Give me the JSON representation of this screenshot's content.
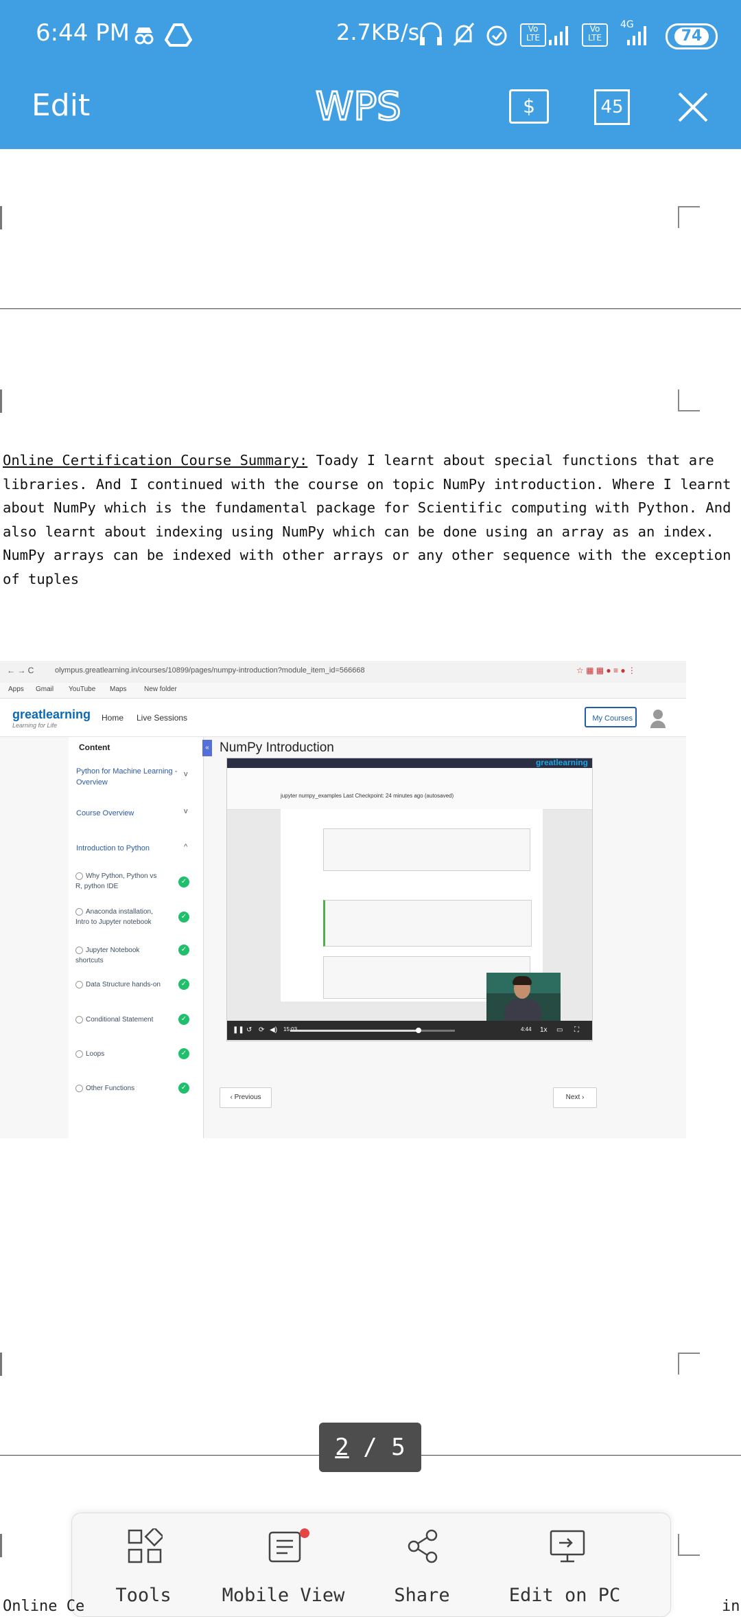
{
  "status_bar": {
    "time": "6:44 PM",
    "net_speed": "2.7KB/s",
    "network_type": "4G",
    "lte_label": "Vo LTE",
    "battery": "74"
  },
  "app_bar": {
    "edit_label": "Edit",
    "logo_text": "WPS",
    "page_count_badge": "45",
    "accent_color": "#3f9fe2"
  },
  "document": {
    "summary_label": "Online Certification Course Summary:",
    "summary_text": " Toady I learnt about special functions that are libraries. And I continued with the course on topic NumPy introduction. Where I learnt about NumPy which is the fundamental package for Scientific computing with Python. And also learnt about indexing using NumPy which can be done using an array as an index. NumPy arrays can be indexed with other arrays or any other sequence with the exception of tuples",
    "cutoff_text_left": "Online Ce",
    "cutoff_text_right": "in"
  },
  "embedded_screenshot": {
    "url": "olympus.greatlearning.in/courses/10899/pages/numpy-introduction?module_item_id=566668",
    "bookmarks": [
      "Apps",
      "Gmail",
      "YouTube",
      "Maps",
      "New folder"
    ],
    "site_logo": "greatlearning",
    "site_tagline": "Learning for Life",
    "nav": {
      "home": "Home",
      "live_sessions": "Live Sessions",
      "my_courses": "My Courses"
    },
    "sidebar_heading": "Content",
    "sidebar_sections": [
      {
        "label": "Python for Machine Learning - Overview",
        "chevron": "v"
      },
      {
        "label": "Course Overview",
        "chevron": "v"
      },
      {
        "label": "Introduction to Python",
        "chevron": "^"
      }
    ],
    "sidebar_lessons": [
      "Why Python, Python vs R, python IDE",
      "Anaconda installation, Intro to Jupyter notebook",
      "Jupyter Notebook shortcuts",
      "Data Structure hands-on",
      "Conditional Statement",
      "Loops",
      "Other Functions"
    ],
    "main_title": "NumPy Introduction",
    "video": {
      "brand": "greatlearning",
      "notebook_title": "jupyter  numpy_examples  Last Checkpoint: 24 minutes ago  (autosaved)",
      "time_elapsed": "15:03",
      "time_remaining": "4:44",
      "speed": "1x",
      "progress": 0.78
    },
    "prev_label": "Previous",
    "next_label": "Next"
  },
  "page_indicator": {
    "current": "2",
    "separator": "/",
    "total": "5"
  },
  "bottom_toolbar": {
    "tools": "Tools",
    "mobile_view": "Mobile View",
    "share": "Share",
    "edit_on_pc": "Edit on PC"
  }
}
